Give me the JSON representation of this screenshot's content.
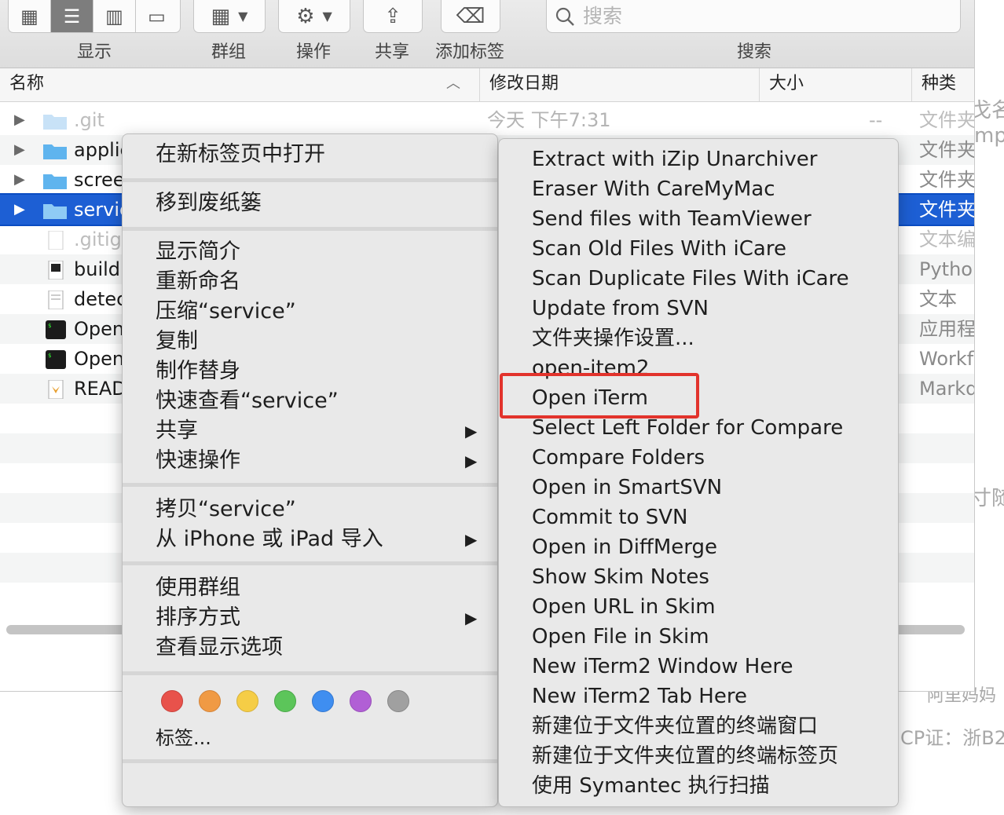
{
  "toolbar": {
    "view_label": "显示",
    "group_label": "群组",
    "action_label": "操作",
    "share_label": "共享",
    "tags_label": "添加标签",
    "search_label": "搜索",
    "search_placeholder": "搜索"
  },
  "columns": {
    "name": "名称",
    "modified": "修改日期",
    "size": "大小",
    "kind": "种类"
  },
  "files": [
    {
      "name": ".git",
      "date": "今天 下午7:31",
      "size": "--",
      "kind": "文件夹"
    },
    {
      "name": "applic",
      "kind": "文件夹"
    },
    {
      "name": "scree",
      "kind": "文件夹"
    },
    {
      "name": "servic",
      "kind": "文件夹"
    },
    {
      "name": ".gitigr",
      "kind": "文本编"
    },
    {
      "name": "build.",
      "kind": "Pythor"
    },
    {
      "name": "detec",
      "kind": "文本"
    },
    {
      "name": "Open",
      "kind": "应用程"
    },
    {
      "name": "Open",
      "kind": "Workfl"
    },
    {
      "name": "READ",
      "kind": "Markd"
    }
  ],
  "background_text": [
    "戈名",
    "mpa",
    "寸随",
    "阿里妈妈",
    "CP证：浙B2"
  ],
  "context_menu": {
    "open_new_tab": "在新标签页中打开",
    "move_to_trash": "移到废纸篓",
    "get_info": "显示简介",
    "rename": "重新命名",
    "compress": "压缩“service”",
    "duplicate": "复制",
    "make_alias": "制作替身",
    "quick_look": "快速查看“service”",
    "share": "共享",
    "quick_actions": "快速操作",
    "copy": "拷贝“service”",
    "import_iphone": "从 iPhone 或 iPad 导入",
    "use_groups": "使用群组",
    "sort_by": "排序方式",
    "show_view_options": "查看显示选项",
    "tags": "标签...",
    "tag_colors": [
      "#e8524b",
      "#f09a44",
      "#f5cd46",
      "#5cc55a",
      "#3f8ef0",
      "#b15fd5",
      "#a0a0a0"
    ]
  },
  "services_menu": [
    "Extract with iZip Unarchiver",
    "Eraser With CareMyMac",
    "Send files with TeamViewer",
    "Scan Old Files With iCare",
    "Scan Duplicate Files With iCare",
    "Update from SVN",
    "文件夹操作设置...",
    "open-item2",
    "Open iTerm",
    "Select Left Folder for Compare",
    "Compare Folders",
    "Open in SmartSVN",
    "Commit to SVN",
    "Open in DiffMerge",
    "Show Skim Notes",
    "Open URL in Skim",
    "Open File in Skim",
    "New iTerm2 Window Here",
    "New iTerm2 Tab Here",
    "新建位于文件夹位置的终端窗口",
    "新建位于文件夹位置的终端标签页",
    "使用 Symantec 执行扫描"
  ],
  "highlight_color": "#e2332c"
}
